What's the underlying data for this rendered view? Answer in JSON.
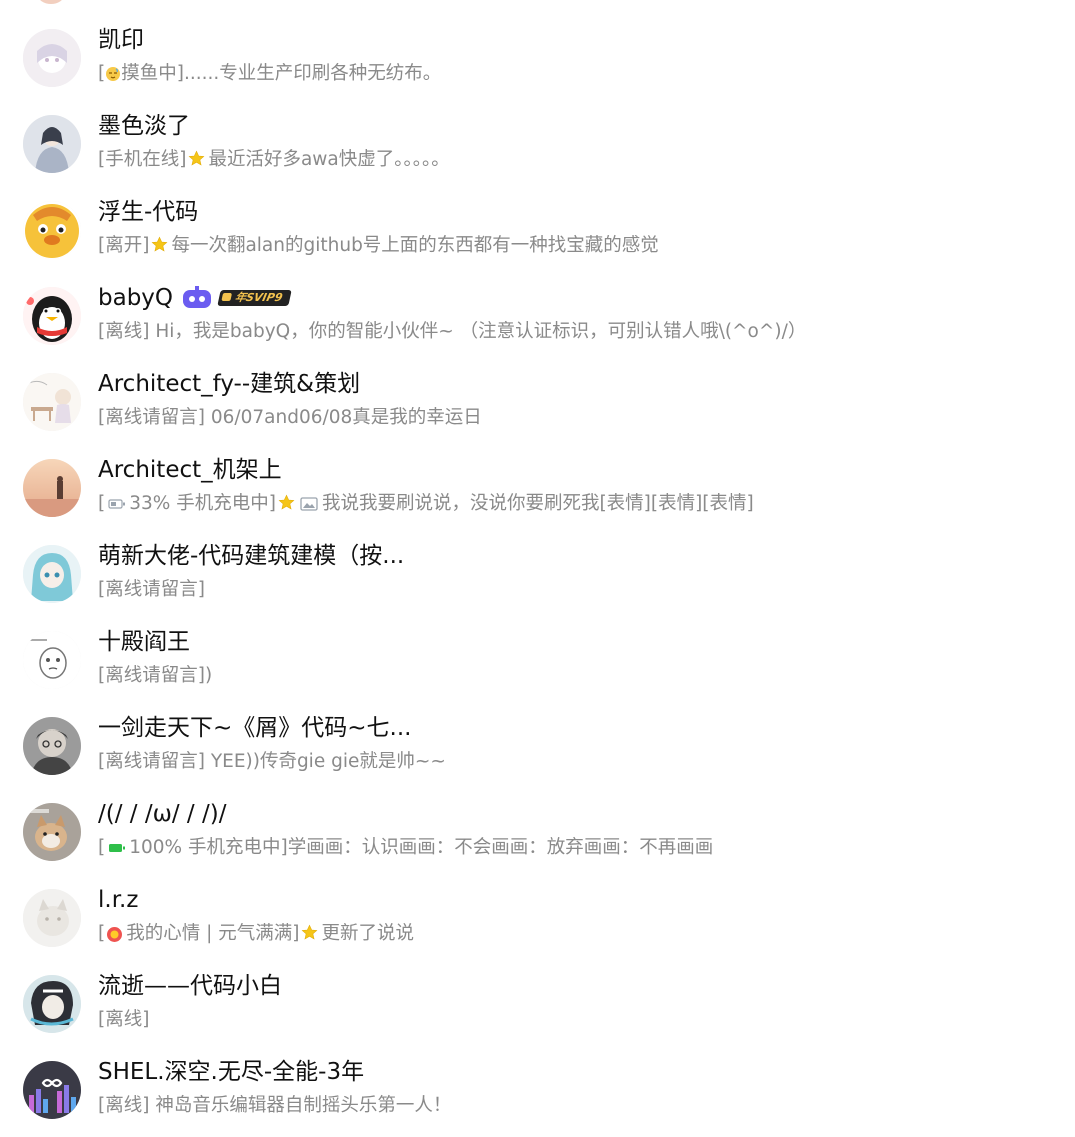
{
  "contacts": [
    {
      "name": "凯印",
      "status_bracket": "[",
      "status_icon": "face-sleepy-icon",
      "status_label": "摸鱼中]",
      "status_text": "......专业生产印刷各种无纺布。"
    },
    {
      "name": "墨色淡了",
      "status_bracket": "[手机在线]",
      "status_icon": "star-icon",
      "status_text": "最近活好多awa快虚了。。。。。"
    },
    {
      "name": "浮生-代码",
      "status_bracket": "[离开]",
      "status_icon": "star-icon",
      "status_text": "每一次翻alan的github号上面的东西都有一种找宝藏的感觉"
    },
    {
      "name": "babyQ",
      "badges": [
        "robot-badge",
        "vip-badge"
      ],
      "vip_text": "年SVIP9",
      "status_bracket": "[离线]",
      "status_text": "Hi，我是babyQ，你的智能小伙伴~ （注意认证标识，可别认错人哦\\(^o^)/）"
    },
    {
      "name": "Architect_fy--建筑&策划",
      "status_bracket": "[离线请留言]",
      "status_text": "06/07and06/08真是我的幸运日"
    },
    {
      "name": "Architect_机架上",
      "status_bracket": "[",
      "status_icon": "battery-low-icon",
      "status_label": "33% 手机充电中]",
      "status_icon2": "star-icon",
      "status_icon3": "image-icon",
      "status_text": "我说我要刷说说，没说你要刷死我[表情][表情][表情]"
    },
    {
      "name": "萌新大佬-代码建筑建模（按...",
      "status_bracket": "[离线请留言]",
      "status_text": ""
    },
    {
      "name": "十殿阎王",
      "status_bracket": "[离线请留言]",
      "status_text": ")"
    },
    {
      "name": "一剑走天下~《屑》代码~七...",
      "status_bracket": "[离线请留言]",
      "status_text": "YEE))传奇gie gie就是帅~~"
    },
    {
      "name": "/(/ / /ω/ / /)/",
      "status_bracket": "[",
      "status_icon": "battery-full-icon",
      "status_label": "100% 手机充电中]",
      "status_text": "学画画：认识画画：不会画画：放弃画画：不再画画"
    },
    {
      "name": "l.r.z",
      "status_bracket": "[",
      "status_icon": "mood-icon",
      "status_label": "我的心情 | 元气满满]",
      "status_icon2": "star-icon",
      "status_text": "更新了说说"
    },
    {
      "name": "流逝——代码小白",
      "status_bracket": "[离线]",
      "status_text": ""
    },
    {
      "name": "SHEL.深空.无尽-全能-3年",
      "status_bracket": "[离线]",
      "status_text": "神岛音乐编辑器自制摇头乐第一人！"
    }
  ],
  "colors": {
    "name": "#111111",
    "status": "#8a8a8a",
    "star": "#f5c518",
    "robot": "#6b5cf0",
    "battery_full": "#2fbf4a",
    "battery_low": "#9aa3ad"
  }
}
